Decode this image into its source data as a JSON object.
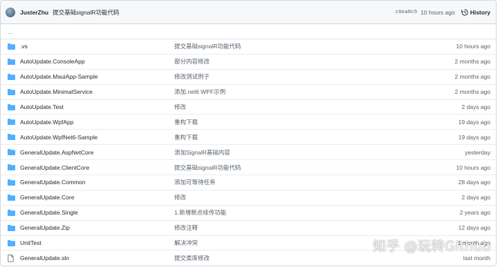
{
  "commit": {
    "author": "JusterZhu",
    "message": "提交基础signalR功能代码",
    "sha": "c6ea8c5",
    "time": "10 hours ago",
    "history_label": "History"
  },
  "parent_dir": "..",
  "colors": {
    "folder": "#54aeff",
    "link": "#0969da",
    "file_icon": "#57606a"
  },
  "files": [
    {
      "type": "folder",
      "name": ".vs",
      "message": "提交基础signalR功能代码",
      "age": "10 hours ago"
    },
    {
      "type": "folder",
      "name": "AutoUpdate.ConsoleApp",
      "message": "部分内容修改",
      "age": "2 months ago"
    },
    {
      "type": "folder",
      "name": "AutoUpdate.MauiApp-Sample",
      "message": "修改测试例子",
      "age": "2 months ago"
    },
    {
      "type": "folder",
      "name": "AutoUpdate.MinimalService",
      "message": "添加.net6 WPF示例",
      "age": "2 months ago"
    },
    {
      "type": "folder",
      "name": "AutoUpdate.Test",
      "message": "修改",
      "age": "2 days ago"
    },
    {
      "type": "folder",
      "name": "AutoUpdate.WpfApp",
      "message": "重构下载",
      "age": "19 days ago"
    },
    {
      "type": "folder",
      "name": "AutoUpdate.WpfNet6-Sample",
      "message": "重构下载",
      "age": "19 days ago"
    },
    {
      "type": "folder",
      "name": "GeneralUpdate.AspNetCore",
      "message": "添加SignalR基础内容",
      "age": "yesterday"
    },
    {
      "type": "folder",
      "name": "GeneralUpdate.ClientCore",
      "message": "提交基础signalR功能代码",
      "age": "10 hours ago"
    },
    {
      "type": "folder",
      "name": "GeneralUpdate.Common",
      "message": "添加可等待任务",
      "age": "28 days ago"
    },
    {
      "type": "folder",
      "name": "GeneralUpdate.Core",
      "message": "修改",
      "age": "2 days ago"
    },
    {
      "type": "folder",
      "name": "GeneralUpdate.Single",
      "message": "1.新增断点续传功能",
      "age": "2 years ago"
    },
    {
      "type": "folder",
      "name": "GeneralUpdate.Zip",
      "message": "修改注释",
      "age": "12 days ago"
    },
    {
      "type": "folder",
      "name": "UnitTest",
      "message": "解决冲突",
      "age": "1 month ago"
    },
    {
      "type": "file",
      "name": "GeneralUpdate.sln",
      "message": "提交类库修改",
      "age": "last month"
    }
  ],
  "watermark": "知乎 @玩转Github"
}
